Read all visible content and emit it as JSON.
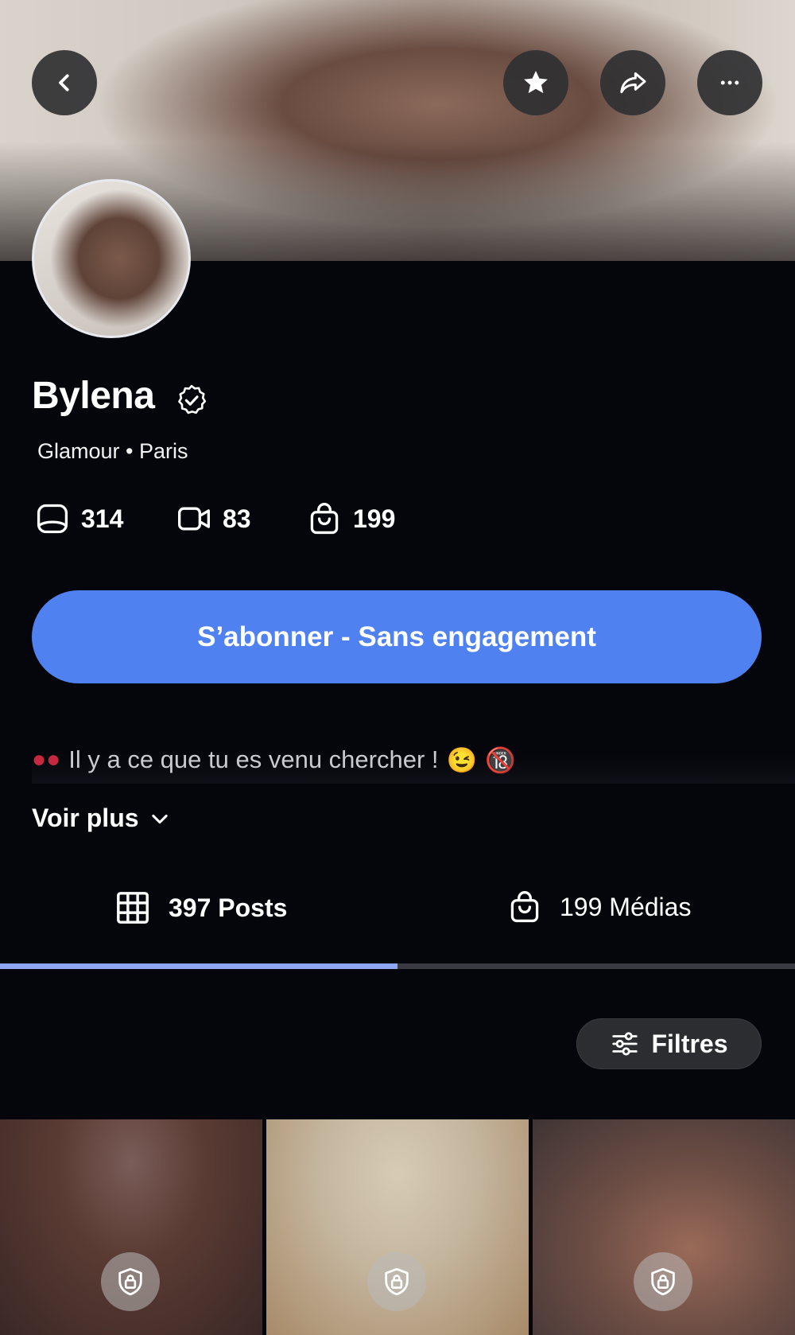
{
  "header": {
    "back_icon": "chevron-left-icon",
    "favorite_icon": "star-icon",
    "share_icon": "share-arrow-icon",
    "more_icon": "ellipsis-icon"
  },
  "profile": {
    "name": "Bylena",
    "verified_icon": "verified-badge-icon",
    "subtitle": "Glamour • Paris"
  },
  "stats": [
    {
      "icon": "photo-icon",
      "value": "314"
    },
    {
      "icon": "video-icon",
      "value": "83"
    },
    {
      "icon": "shopping-bag-icon",
      "value": "199"
    }
  ],
  "subscribe_button": "S’abonner - Sans engagement",
  "bio": {
    "text": "Il y a ce que tu es venu chercher !",
    "emoji_1": "😉",
    "emoji_2": "🔞"
  },
  "voir_plus": "Voir plus",
  "tabs": [
    {
      "label": "397 Posts",
      "icon": "grid-icon",
      "active": true
    },
    {
      "label": "199 Médias",
      "icon": "shopping-bag-icon",
      "active": false
    }
  ],
  "filters_label": "Filtres",
  "colors": {
    "background": "#05060b",
    "accent": "#4f81f1",
    "tab_indicator": "#8ea6f3"
  }
}
